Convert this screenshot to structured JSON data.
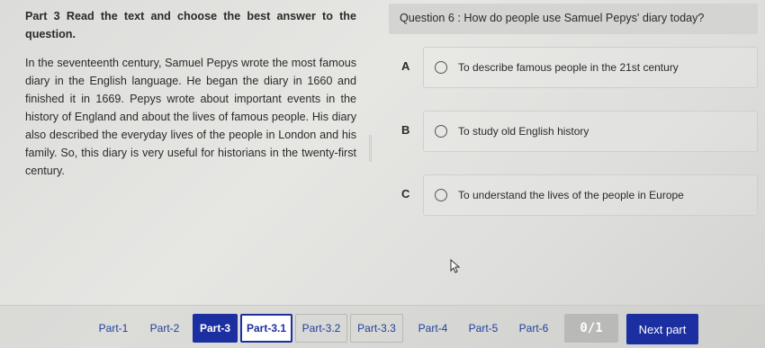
{
  "passage": {
    "title": "Part 3 Read the text and choose the best answer to the question.",
    "text": "In the seventeenth century, Samuel Pepys wrote the most famous diary in the English language. He began the diary in 1660 and finished it in 1669. Pepys wrote about important events in the history of England and about the lives of famous people. His diary also described the everyday lives of the people in London and his family. So, this diary is very useful for historians in the twenty-first century."
  },
  "question": {
    "label": "Question 6 : How do people use Samuel Pepys' diary today?"
  },
  "options": [
    {
      "letter": "A",
      "text": "To describe famous people in the 21st century"
    },
    {
      "letter": "B",
      "text": "To study old English history"
    },
    {
      "letter": "C",
      "text": "To understand the lives of the people in Europe"
    }
  ],
  "nav": {
    "tabs": [
      "Part-1",
      "Part-2",
      "Part-3",
      "Part-3.1",
      "Part-3.2",
      "Part-3.3",
      "Part-4",
      "Part-5",
      "Part-6"
    ],
    "active_tab": "Part-3",
    "current_subtab": "Part-3.1",
    "counter": "0/1",
    "next_label": "Next part"
  }
}
